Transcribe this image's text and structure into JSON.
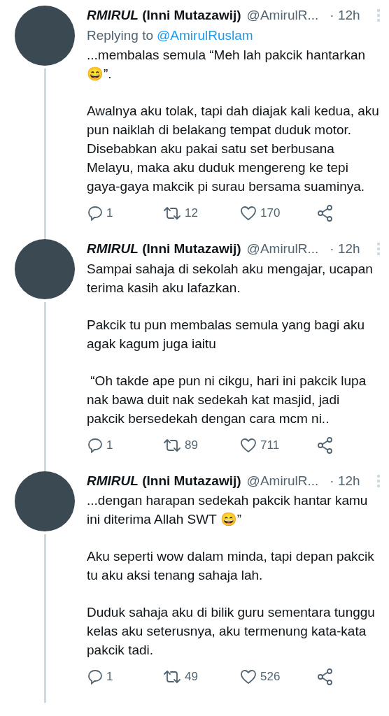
{
  "tweets": [
    {
      "name": "*RMIRUL* (Inni Mutazawij)",
      "handle": "@AmirulR...",
      "time": "· 12h",
      "replying_label": "Replying to",
      "replying_to": "@AmirulRuslam",
      "paragraphs": [
        "...membalas semula “Meh lah pakcik hantarkan 😄”.",
        "Awalnya aku tolak, tapi dah diajak kali kedua, aku pun naiklah di belakang tempat duduk motor. Disebabkan aku pakai satu set berbusana Melayu, maka aku duduk mengereng ke tepi gaya-gaya makcik pi surau bersama suaminya."
      ],
      "replies": "1",
      "retweets": "12",
      "likes": "170"
    },
    {
      "name": "*RMIRUL* (Inni Mutazawij)",
      "handle": "@AmirulR...",
      "time": "· 12h",
      "paragraphs": [
        "Sampai sahaja di sekolah aku mengajar, ucapan terima kasih aku lafazkan.",
        "Pakcik tu pun membalas semula yang bagi aku agak kagum juga iaitu",
        " “Oh takde ape pun ni cikgu, hari ini pakcik lupa nak bawa duit nak sedekah kat masjid, jadi pakcik bersedekah dengan cara mcm ni.."
      ],
      "replies": "1",
      "retweets": "89",
      "likes": "711"
    },
    {
      "name": "*RMIRUL* (Inni Mutazawij)",
      "handle": "@AmirulR...",
      "time": "· 12h",
      "paragraphs": [
        "...dengan harapan sedekah pakcik hantar kamu ini diterima Allah SWT 😄”",
        "Aku seperti wow dalam minda, tapi depan pakcik tu aku aksi tenang sahaja lah.",
        "Duduk sahaja aku di bilik guru sementara tunggu kelas aku seterusnya, aku termenung kata-kata pakcik tadi."
      ],
      "replies": "1",
      "retweets": "49",
      "likes": "526"
    }
  ]
}
